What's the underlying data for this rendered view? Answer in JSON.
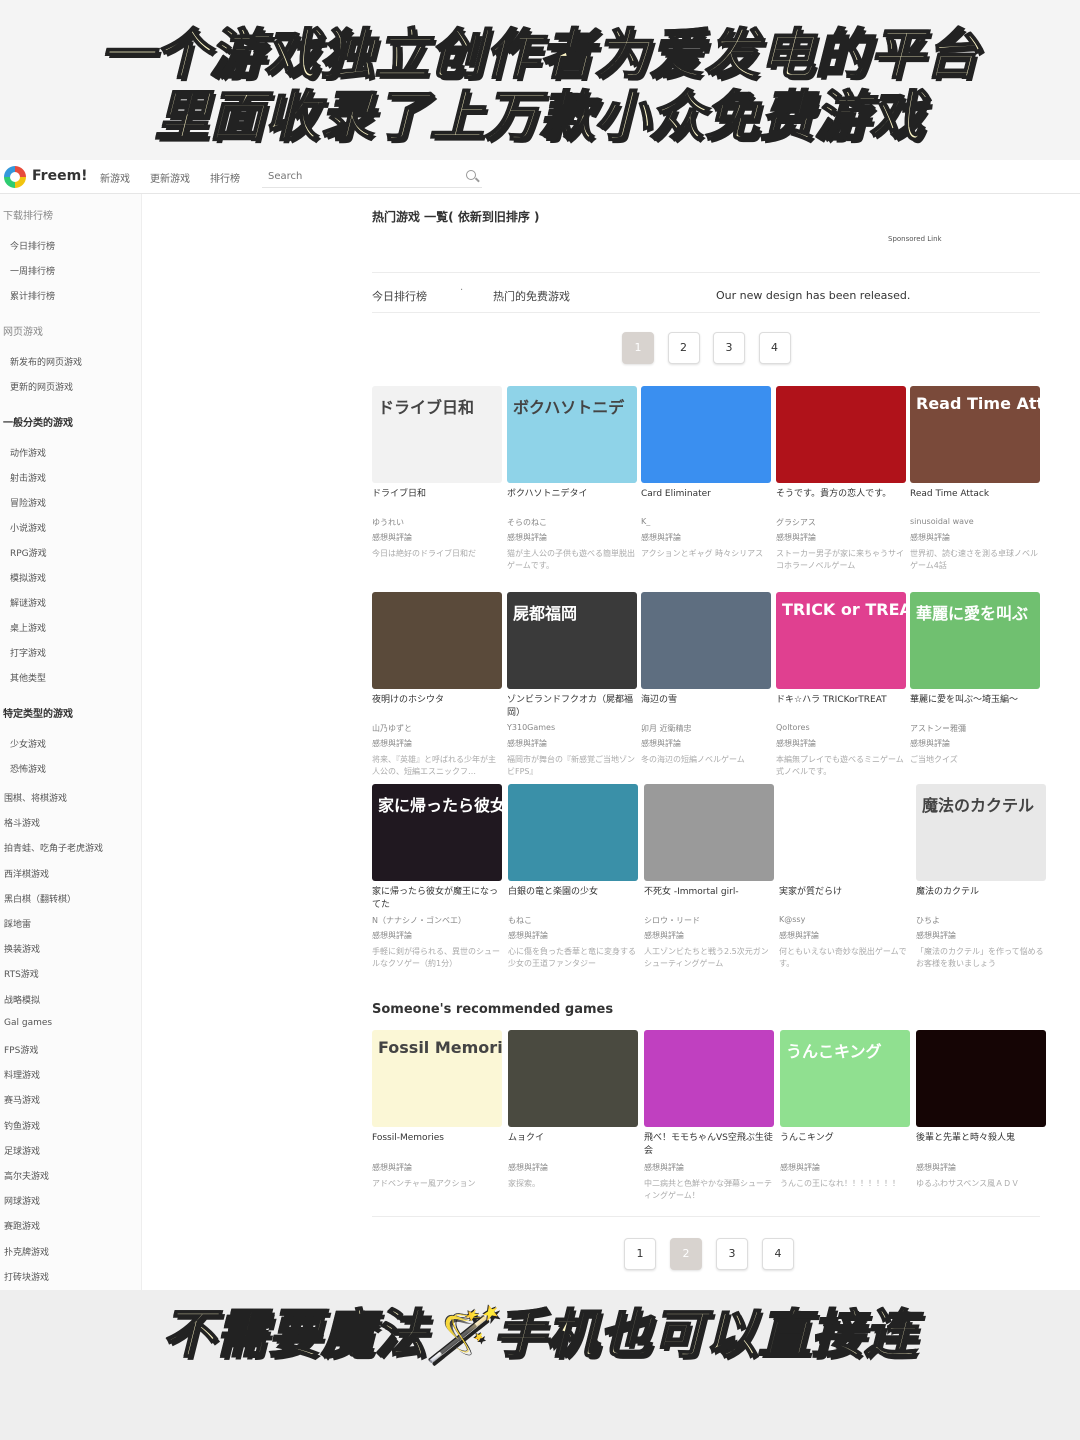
{
  "banner": {
    "top_line1": "一个游戏独立创作者为爱发电的平台",
    "top_line2": "里面收录了上万款小众免费游戏",
    "bottom_line": "不需要魔法🪄手机也可以直接连"
  },
  "nav": {
    "logo": "Freem!",
    "links": [
      "新游戏",
      "更新游戏",
      "排行榜"
    ],
    "search_placeholder": "Search"
  },
  "sidebar": {
    "sections": [
      {
        "heading": "下载排行榜",
        "items": [
          "今日排行榜",
          "一周排行榜",
          "累计排行榜"
        ]
      },
      {
        "heading": "网页游戏",
        "items": [
          "新发布的网页游戏",
          "更新的网页游戏"
        ]
      },
      {
        "heading": "一般分类的游戏",
        "items": [
          "动作游戏",
          "射击游戏",
          "冒险游戏",
          "小说游戏",
          "RPG游戏",
          "模拟游戏",
          "解谜游戏",
          "桌上游戏",
          "打字游戏",
          "其他类型"
        ]
      },
      {
        "heading": "特定类型的游戏",
        "items": [
          "少女游戏",
          "恐怖游戏"
        ]
      }
    ],
    "more": [
      "围棋、将棋游戏",
      "格斗游戏",
      "拍青蛙、吃角子老虎游戏",
      "西洋棋游戏",
      "黑白棋（翻转棋）",
      "踩地雷",
      "换装游戏",
      "RTS游戏",
      "战略模拟",
      "Gal games",
      "FPS游戏",
      "料理游戏",
      "赛马游戏",
      "钓鱼游戏",
      "足球游戏",
      "高尔夫游戏",
      "网球游戏",
      "赛跑游戏",
      "扑克牌游戏",
      "打砖块游戏"
    ]
  },
  "main": {
    "title": "热门游戏 一覧( 依新到旧排序 )",
    "sponsored": "Sponsored Link",
    "tab1": "今日排行榜",
    "tab_sep": "·",
    "tab2": "热门的免费游戏",
    "announcement": "Our new design has been released.",
    "pages": [
      "1",
      "2",
      "3",
      "4"
    ],
    "games": [
      {
        "title": "ドライブ日和",
        "author": "ゆうれい",
        "review": "感想與評論",
        "desc": "今日は絶好のドライブ日和だ",
        "thumb_text": "ドライブ日和",
        "bg": "#f2f2f2"
      },
      {
        "title": "ボクハソトニデタイ",
        "author": "そらのねこ",
        "review": "感想與評論",
        "desc": "猫が主人公の子供も遊べる簡単脱出ゲームです。",
        "thumb_text": "ボクハソトニデ",
        "bg": "#8fd3e8"
      },
      {
        "title": "Card Eliminater",
        "author": "K_",
        "review": "感想與評論",
        "desc": "アクションとギャグ 時々シリアス",
        "thumb_text": "",
        "bg": "#3a8ff0"
      },
      {
        "title": "そうです。貴方の恋人です。",
        "author": "グラシアス",
        "review": "感想與評論",
        "desc": "ストーカー男子が家に来ちゃうサイコホラーノベルゲーム",
        "thumb_text": "",
        "bg": "#b0121a"
      },
      {
        "title": "Read Time Attack",
        "author": "sinusoidal wave",
        "review": "感想與評論",
        "desc": "世界初、読む速さを測る卓球ノベルゲーム4話",
        "thumb_text": "Read Time Attack",
        "bg": "#7a4a3a"
      },
      {
        "title": "夜明けのホシウタ",
        "author": "山乃ゆずと",
        "review": "感想與評論",
        "desc": "将来、『英雄』と呼ばれる少年が主人公の、短編エスニックフ…",
        "thumb_text": "",
        "bg": "#5a4a3a"
      },
      {
        "title": "ゾンビランドフクオカ（屍都福岡）",
        "author": "Y310Games",
        "review": "感想與評論",
        "desc": "福岡市が舞台の『新感覚ご当地ゾンビFPS』",
        "thumb_text": "屍都福岡",
        "bg": "#3a3a3a"
      },
      {
        "title": "海辺の雪",
        "author": "卯月 近衛精忠",
        "review": "感想與評論",
        "desc": "冬の海辺の短編ノベルゲーム",
        "thumb_text": "",
        "bg": "#5e6e80"
      },
      {
        "title": "ドキ☆ハラ TRICKorTREAT",
        "author": "Qoltores",
        "review": "感想與評論",
        "desc": "本編無プレイでも遊べるミニゲーム式ノベルです。",
        "thumb_text": "TRICK or TREAT",
        "bg": "#e04090"
      },
      {
        "title": "華麗に愛を叫ぶ～埼玉編～",
        "author": "アストン＝雅彌",
        "review": "感想與評論",
        "desc": "ご当地クイズ",
        "thumb_text": "華麗に愛を叫ぶ",
        "bg": "#70c070"
      },
      {
        "title": "家に帰ったら彼女が魔王になってた",
        "author": "N（ナナシノ・ゴンベエ）",
        "review": "感想與評論",
        "desc": "手軽に剣が得られる、異世のシュールなクソゲー（約1分）",
        "thumb_text": "家に帰ったら彼女が",
        "bg": "#201820"
      },
      {
        "title": "白銀の竜と楽園の少女",
        "author": "もねこ",
        "review": "感想與評論",
        "desc": "心に傷を負った香華と竜に変身する少女の王道ファンタジー",
        "thumb_text": "",
        "bg": "#3a90a8"
      },
      {
        "title": "不死女 -Immortal girl-",
        "author": "シロウ・リード",
        "review": "感想與評論",
        "desc": "人工ゾンビたちと戦う2.5次元ガンシューティングゲーム",
        "thumb_text": "",
        "bg": "#9a9a9a"
      },
      {
        "title": "実家が質だらけ",
        "author": "K@ssy",
        "review": "感想與評論",
        "desc": "何ともいえない奇妙な脱出ゲームです。",
        "thumb_text": "",
        "bg": "#ffffff"
      },
      {
        "title": "魔法のカクテル",
        "author": "ひちよ",
        "review": "感想與評論",
        "desc": "「魔法のカクテル」を作って悩めるお客様を救いましょう",
        "thumb_text": "魔法のカクテル",
        "bg": "#e8e8e8"
      }
    ],
    "rec_title": "Someone's recommended games",
    "rec_games": [
      {
        "title": "Fossil-Memories",
        "review": "感想與評論",
        "desc": "アドベンチャー風アクション",
        "thumb_text": "Fossil Memories",
        "bg": "#fbf7d6"
      },
      {
        "title": "ムョクイ",
        "review": "感想與評論",
        "desc": "家探索。",
        "thumb_text": "",
        "bg": "#4a4a40"
      },
      {
        "title": "飛べ！モモちゃんVS空飛ぶ生徒会",
        "review": "感想與評論",
        "desc": "中二病共と色鮮やかな弾幕シューティングゲーム！",
        "thumb_text": "",
        "bg": "#c040c0"
      },
      {
        "title": "うんこキング",
        "review": "感想與評論",
        "desc": "うんこの王になれ！！！！！！！",
        "thumb_text": "うんこキング",
        "bg": "#90e090"
      },
      {
        "title": "後輩と先輩と時々殺人鬼",
        "review": "感想與評論",
        "desc": "ゆるふわサスペンス風ＡＤＶ",
        "thumb_text": "",
        "bg": "#150505"
      }
    ]
  },
  "colors": {
    "active_page": "#d8d3cf",
    "banner_text": "#fff8c8"
  }
}
